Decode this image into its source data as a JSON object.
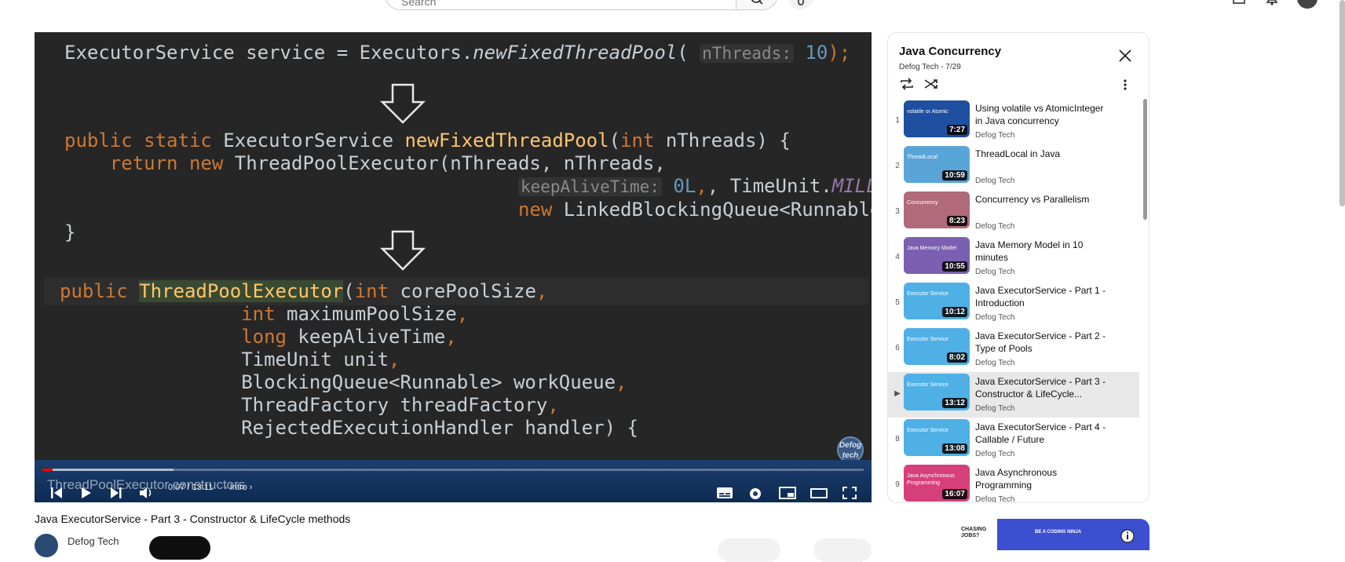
{
  "topbar": {
    "search_placeholder": "Search"
  },
  "player": {
    "code_line1_a": "ExecutorService service = Executors.",
    "code_line1_fn": "newFixedThreadPool",
    "code_line1_paren": "(",
    "code_line1_hint": "nThreads:",
    "code_line1_num": "10",
    "code_line1_end": ");",
    "code_b1_kw": "public static",
    "code_b1_type": " ExecutorService ",
    "code_b1_fn": "newFixedThreadPool",
    "code_b1_rest_a": "(",
    "code_b1_int": "int",
    "code_b1_rest_b": " nThreads) {",
    "code_b2_ret": "    return new",
    "code_b2_rest": " ThreadPoolExecutor(nThreads, nThreads,",
    "code_b3_hint": "keepAliveTime:",
    "code_b3_num": " 0L",
    "code_b3_rest": ", TimeUnit.",
    "code_b3_const": "MILLISECONDS",
    "code_b3_comma": ",",
    "code_b4_new": "new",
    "code_b4_rest": " LinkedBlockingQueue<Runnable>());",
    "code_b5": "}",
    "code_c1_kw": "public ",
    "code_c1_fn": "ThreadPoolExecutor",
    "code_c1_paren": "(",
    "code_c1_int": "int",
    "code_c1_rest": " corePoolSize",
    "code_c1_comma": ",",
    "code_c2_int": "int",
    "code_c2_rest": " maximumPoolSize",
    "code_c2_comma": ",",
    "code_c3_long": "long",
    "code_c3_rest": " keepAliveTime",
    "code_c3_comma": ",",
    "code_c4": "TimeUnit unit",
    "code_c4_comma": ",",
    "code_c5": "BlockingQueue<Runnable> workQueue",
    "code_c5_comma": ",",
    "code_c6": "ThreadFactory threadFactory",
    "code_c6_comma": ",",
    "code_c7": "RejectedExecutionHandler handler) {",
    "logo_text": "Defog tech",
    "chapter_overlay": "ThreadPoolExecutor constructors",
    "time": "0:07 / 13:11",
    "chapter": "· Intro ›",
    "progress_played": 0.012,
    "progress_buffered": 0.16
  },
  "video": {
    "title": "Java ExecutorService - Part 3 - Constructor & LifeCycle methods",
    "channel": "Defog Tech"
  },
  "playlist": {
    "title": "Java Concurrency",
    "subtitle": "Defog Tech - 7/29",
    "items": [
      {
        "index": "1",
        "title": "Using volatile vs AtomicInteger in Java concurrency",
        "channel": "Defog Tech",
        "duration": "7:27",
        "thumb_text": "volatile or Atomic",
        "thumb_color": "#1e4fa0"
      },
      {
        "index": "2",
        "title": "ThreadLocal in Java",
        "channel": "Defog Tech",
        "duration": "10:59",
        "thumb_text": "ThreadLocal",
        "thumb_color": "#5aa5d8"
      },
      {
        "index": "3",
        "title": "Concurrency vs Parallelism",
        "channel": "Defog Tech",
        "duration": "8:23",
        "thumb_text": "Concurrency",
        "thumb_color": "#b06a7a"
      },
      {
        "index": "4",
        "title": "Java Memory Model in 10 minutes",
        "channel": "Defog Tech",
        "duration": "10:55",
        "thumb_text": "Java Memory Model",
        "thumb_color": "#7b5fb0"
      },
      {
        "index": "5",
        "title": "Java ExecutorService - Part 1 - Introduction",
        "channel": "Defog Tech",
        "duration": "10:12",
        "thumb_text": "Executor Service",
        "thumb_color": "#4fb0e6"
      },
      {
        "index": "6",
        "title": "Java ExecutorService - Part 2 - Type of Pools",
        "channel": "Defog Tech",
        "duration": "8:02",
        "thumb_text": "Executor Service",
        "thumb_color": "#4fb0e6"
      },
      {
        "index": "▶",
        "title": "Java ExecutorService - Part 3 - Constructor & LifeCycle...",
        "channel": "Defog Tech",
        "duration": "13:12",
        "thumb_text": "Executor Service",
        "thumb_color": "#4fb0e6"
      },
      {
        "index": "8",
        "title": "Java ExecutorService - Part 4 - Callable / Future",
        "channel": "Defog Tech",
        "duration": "13:08",
        "thumb_text": "Executor Service",
        "thumb_color": "#4fb0e6"
      },
      {
        "index": "9",
        "title": "Java Asynchronous Programming",
        "channel": "Defog Tech",
        "duration": "16:07",
        "thumb_text": "Java Asynchronous Programming",
        "thumb_color": "#d6407a"
      }
    ]
  },
  "ad": {
    "left_text": "CHASING JOBS?",
    "right_text": "BE A CODING NINJA"
  },
  "colors": {
    "player_bg": "#262626",
    "keyword": "#cc7832",
    "function": "#ffc66d",
    "number": "#6897bb",
    "constant": "#9876aa",
    "progress": "#ff0000"
  }
}
